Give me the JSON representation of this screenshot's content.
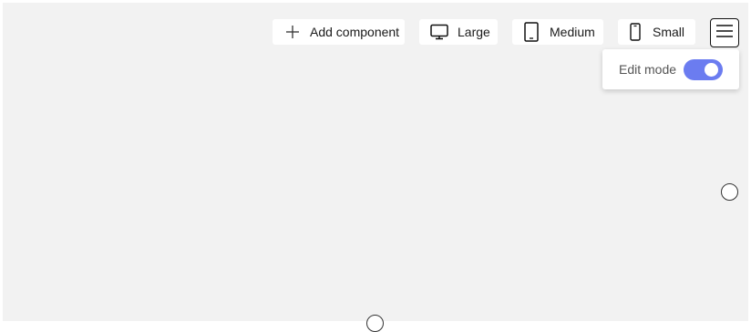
{
  "toolbar": {
    "add_component": {
      "label": "Add component",
      "icon": "plus-icon"
    },
    "large": {
      "label": "Large",
      "icon": "monitor-icon"
    },
    "medium": {
      "label": "Medium",
      "icon": "tablet-icon"
    },
    "small": {
      "label": "Small",
      "icon": "phone-icon"
    },
    "menu": {
      "icon": "hamburger-menu-icon"
    }
  },
  "edit_mode": {
    "label": "Edit mode",
    "enabled": true,
    "accent_color": "#6b7cf0"
  },
  "canvas": {
    "background_color": "#f2f2f2"
  }
}
